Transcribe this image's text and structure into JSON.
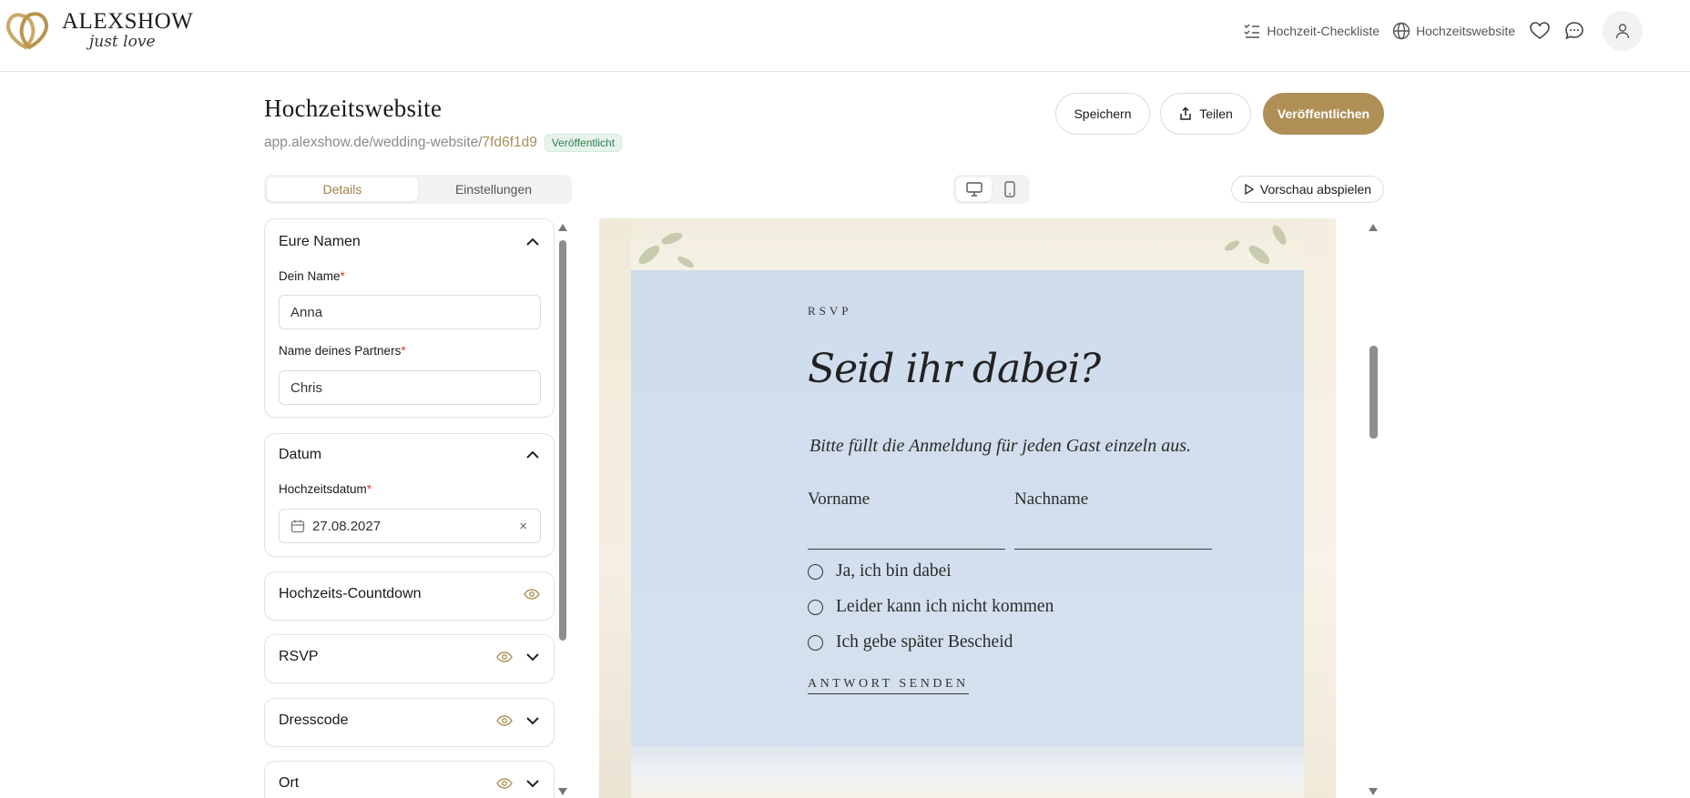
{
  "brand": {
    "name": "ALEXSHOW",
    "tagline": "just love",
    "accent": "#b08f57"
  },
  "topnav": {
    "checklist_label": "Hochzeit-Checkliste",
    "website_label": "Hochzeitswebsite",
    "icons": [
      "checklist-icon",
      "globe-icon",
      "heart-icon",
      "chat-icon",
      "user-icon"
    ]
  },
  "header": {
    "title": "Hochzeitswebsite",
    "url_base": "app.alexshow.de/wedding-website/",
    "url_id": "7fd6f1d9",
    "status_badge": "Veröffentlicht"
  },
  "actions": {
    "save": "Speichern",
    "share": "Teilen",
    "publish": "Veröffentlichen",
    "preview": "Vorschau abspielen"
  },
  "tabs": [
    {
      "label": "Details",
      "active": true
    },
    {
      "label": "Einstellungen",
      "active": false
    }
  ],
  "sections": {
    "names": {
      "title": "Eure Namen",
      "your_name_label": "Dein Name",
      "your_name_value": "Anna",
      "partner_label": "Name deines Partners",
      "partner_value": "Chris",
      "required_mark": "*"
    },
    "date": {
      "title": "Datum",
      "wedding_date_label": "Hochzeitsdatum",
      "wedding_date_value": "27.08.2027",
      "clear_symbol": "×"
    },
    "countdown": {
      "title": "Hochzeits-Countdown"
    },
    "rsvp": {
      "title": "RSVP"
    },
    "dresscode": {
      "title": "Dresscode"
    },
    "location": {
      "title": "Ort"
    }
  },
  "preview": {
    "kicker": "RSVP",
    "title": "Seid ihr dabei?",
    "subtitle": "Bitte füllt die Anmeldung für jeden Gast einzeln aus.",
    "first_name_label": "Vorname",
    "last_name_label": "Nachname",
    "options": [
      "Ja, ich bin dabei",
      "Leider kann ich nicht kommen",
      "Ich gebe später Bescheid"
    ],
    "submit": "ANTWORT SENDEN",
    "box_color": "#cfdcec"
  }
}
